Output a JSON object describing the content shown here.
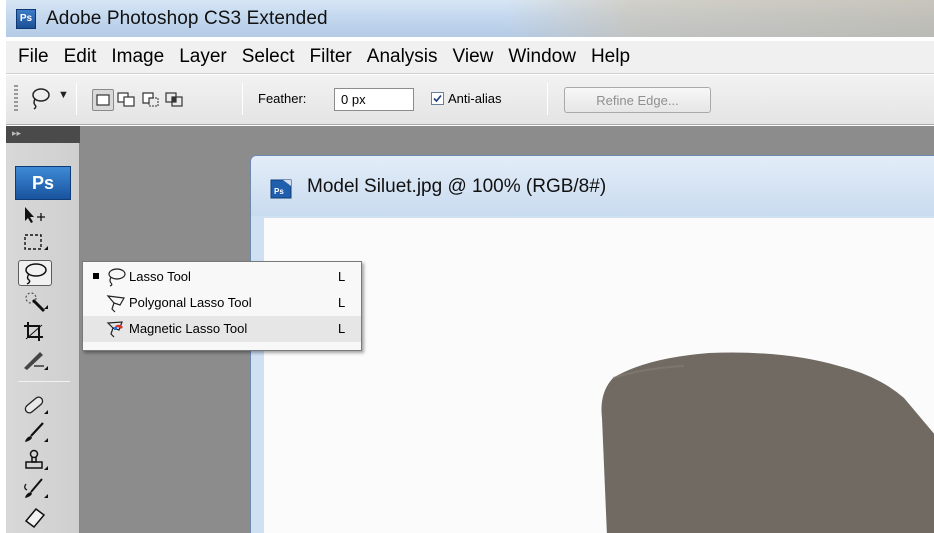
{
  "window": {
    "app_badge": "Ps",
    "title": "Adobe Photoshop CS3 Extended"
  },
  "menu": [
    "File",
    "Edit",
    "Image",
    "Layer",
    "Select",
    "Filter",
    "Analysis",
    "View",
    "Window",
    "Help"
  ],
  "options": {
    "feather_label": "Feather:",
    "feather_value": "0 px",
    "antialias_label": "Anti-alias",
    "antialias_checked": true,
    "refine_label": "Refine Edge..."
  },
  "toolbox": {
    "collapse_glyph": "▸▸",
    "logo": "Ps",
    "tools": [
      "move-icon",
      "rectangular-marquee-icon",
      "lasso-icon",
      "quick-selection-icon",
      "crop-icon",
      "slice-icon",
      "healing-brush-icon",
      "brush-icon",
      "clone-stamp-icon",
      "history-brush-icon",
      "eraser-icon"
    ],
    "selected_tool": "lasso-icon"
  },
  "flyout": [
    {
      "label": "Lasso Tool",
      "key": "L",
      "icon": "lasso-icon",
      "active": true
    },
    {
      "label": "Polygonal Lasso Tool",
      "key": "L",
      "icon": "polygonal-lasso-icon",
      "active": false
    },
    {
      "label": "Magnetic Lasso Tool",
      "key": "L",
      "icon": "magnetic-lasso-icon",
      "active": false
    }
  ],
  "document": {
    "icon_text": "Ps",
    "title": "Model Siluet.jpg @ 100% (RGB/8#)"
  },
  "colors": {
    "workspace": "#8c8c8c",
    "doc_frame": "#cfe0f2",
    "hijab": "#716a63"
  }
}
